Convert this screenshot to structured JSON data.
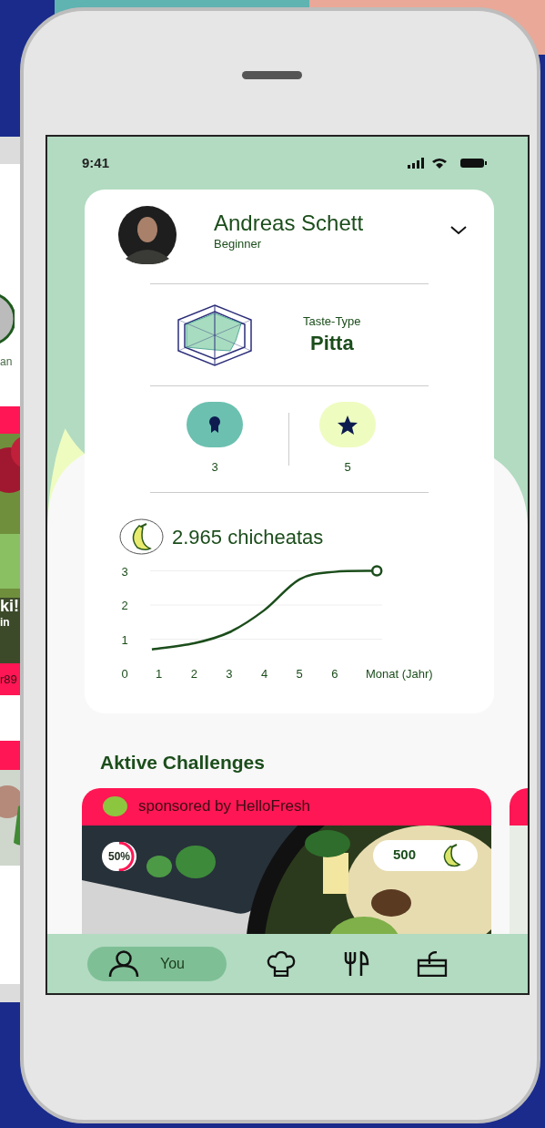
{
  "status_bar": {
    "time": "9:41"
  },
  "profile": {
    "name": "Andreas Schett",
    "level": "Beginner"
  },
  "taste_type": {
    "label": "Taste-Type",
    "value": "Pitta"
  },
  "badges": [
    {
      "kind": "medal",
      "count": "3",
      "color": "#6cc0b0"
    },
    {
      "kind": "star",
      "count": "5",
      "color": "#eefcc0"
    }
  ],
  "points": {
    "value": "2.965 chicheatas",
    "chart_data": {
      "type": "line",
      "x": [
        0.8,
        2,
        3,
        4,
        5,
        6,
        7.2
      ],
      "grid": true,
      "series": [
        {
          "color": "#1b4d1b",
          "values": [
            0.7,
            0.88,
            1.2,
            1.85,
            2.75,
            2.97,
            3.0
          ]
        }
      ],
      "xlabel": "Monat (Jahr)",
      "xticks": [
        1,
        2,
        3,
        4,
        5,
        6
      ],
      "yticks": [
        0,
        1,
        2,
        3
      ],
      "xlim": [
        0.75,
        7.35
      ],
      "ylim": [
        0,
        3
      ]
    }
  },
  "challenges": {
    "title": "Aktive Challenges",
    "cards": [
      {
        "sponsor": "sponsored by HelloFresh",
        "progress": "50%",
        "level": 0.5,
        "reward": "500"
      }
    ]
  },
  "nav": [
    {
      "kind": "person",
      "label": "You",
      "selected": true
    },
    {
      "kind": "chef-hat",
      "selected": false
    },
    {
      "kind": "cutlery",
      "selected": false
    },
    {
      "kind": "box",
      "selected": false
    }
  ],
  "side_phone": {
    "texts": [
      "an",
      "ki!",
      "in",
      "r89"
    ]
  }
}
